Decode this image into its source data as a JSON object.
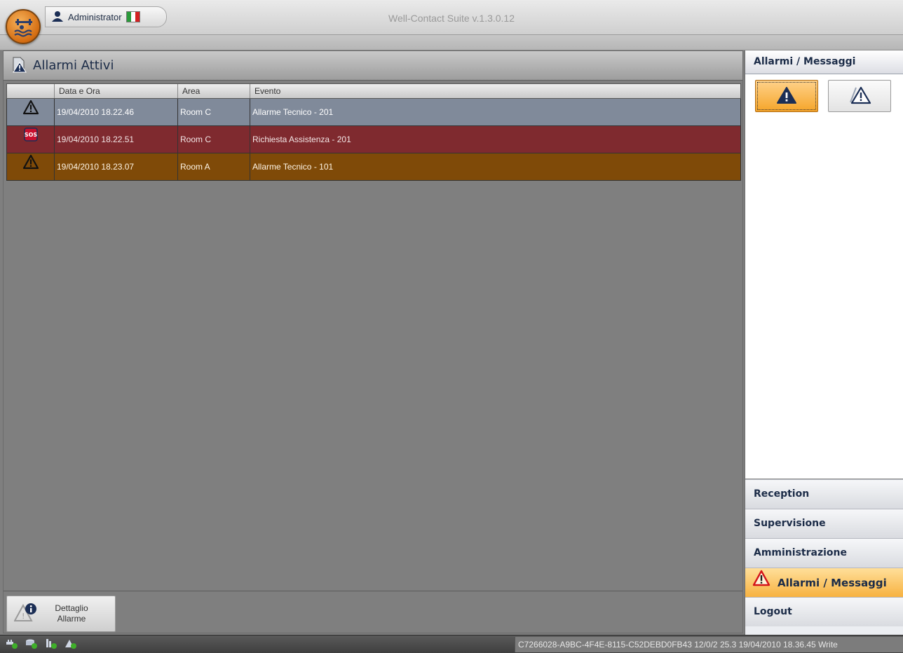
{
  "titlebar": {
    "app_title": "Well-Contact Suite v.1.3.0.12",
    "user": "Administrator",
    "flag_colors": [
      "#2a9a3a",
      "#ffffff",
      "#d32222"
    ]
  },
  "main": {
    "title": "Allarmi Attivi",
    "columns": [
      "",
      "Data e Ora",
      "Area",
      "Evento"
    ],
    "rows": [
      {
        "icon": "warning-triangle-icon",
        "datetime": "19/04/2010 18.22.46",
        "area": "Room C",
        "event": "Allarme Tecnico - 201",
        "bg": "#808a9a",
        "fg": "#ffffff"
      },
      {
        "icon": "sos-icon",
        "datetime": "19/04/2010 18.22.51",
        "area": "Room C",
        "event": "Richiesta Assistenza - 201",
        "bg": "#7f2a2f",
        "fg": "#f3e6e6"
      },
      {
        "icon": "warning-triangle-icon",
        "datetime": "19/04/2010 18.23.07",
        "area": "Room A",
        "event": "Allarme Tecnico - 101",
        "bg": "#7f4a08",
        "fg": "#fff5e6"
      }
    ],
    "detail_button": {
      "line1": "Dettaglio",
      "line2": "Allarme"
    }
  },
  "side": {
    "header": "Allarmi / Messaggi",
    "nav": [
      {
        "label": "Reception"
      },
      {
        "label": "Supervisione"
      },
      {
        "label": "Amministrazione"
      },
      {
        "label": "Allarmi / Messaggi",
        "active": true
      },
      {
        "label": "Logout"
      }
    ]
  },
  "statusbar": {
    "text": "C7266028-A9BC-4F4E-8115-C52DEBD0FB43 12/0/2 25.3 19/04/2010 18.36.45 Write"
  }
}
